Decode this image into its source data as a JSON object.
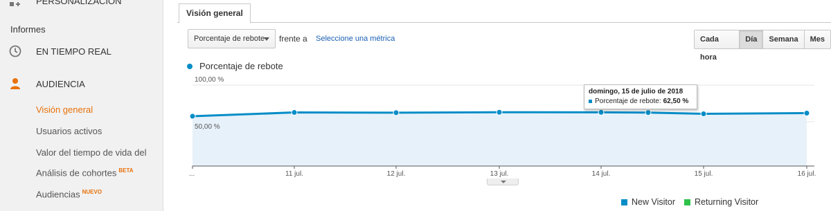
{
  "sidebar": {
    "personalization": "PERSONALIZACIÓN",
    "section": "Informes",
    "realtime": "EN TIEMPO REAL",
    "audience": "AUDIENCIA",
    "sub_items": [
      {
        "label": "Visión general",
        "active": true
      },
      {
        "label": "Usuarios activos",
        "active": false
      },
      {
        "label": "Valor del tiempo de vida del",
        "active": false
      },
      {
        "label": "Análisis de cohortes",
        "badge": "BETA",
        "active": false
      },
      {
        "label": "Audiencias",
        "badge": "NUEVO",
        "active": false
      }
    ]
  },
  "tabs": {
    "overview": "Visión general"
  },
  "controls": {
    "metric": "Porcentaje de rebote",
    "vs": "frente a",
    "select_metric": "Seleccione una métrica",
    "granularity": [
      "Cada hora",
      "Día",
      "Semana",
      "Mes"
    ],
    "granularity_selected": "Día"
  },
  "chart_data": {
    "type": "area",
    "series": [
      {
        "name": "Porcentaje de rebote",
        "color": "#058dc7",
        "values": [
          57.5,
          62.7,
          62.4,
          63.0,
          62.8,
          62.5,
          60.8,
          61.8
        ]
      }
    ],
    "x_tick_labels": [
      "...",
      "11 jul.",
      "12 jul.",
      "13 jul.",
      "14 jul.",
      "15 jul.",
      "16 jul."
    ],
    "y_tick_labels": [
      "100,00 %",
      "50,00 %"
    ],
    "ylim": [
      0,
      100
    ],
    "grid": true
  },
  "tooltip": {
    "date": "domingo, 15 de julio de 2018",
    "metric": "Porcentaje de rebote:",
    "value": "62,50 %"
  },
  "legend_bottom": [
    {
      "label": "New Visitor",
      "color": "#058dc7"
    },
    {
      "label": "Returning Visitor",
      "color": "#2ec24a"
    }
  ]
}
